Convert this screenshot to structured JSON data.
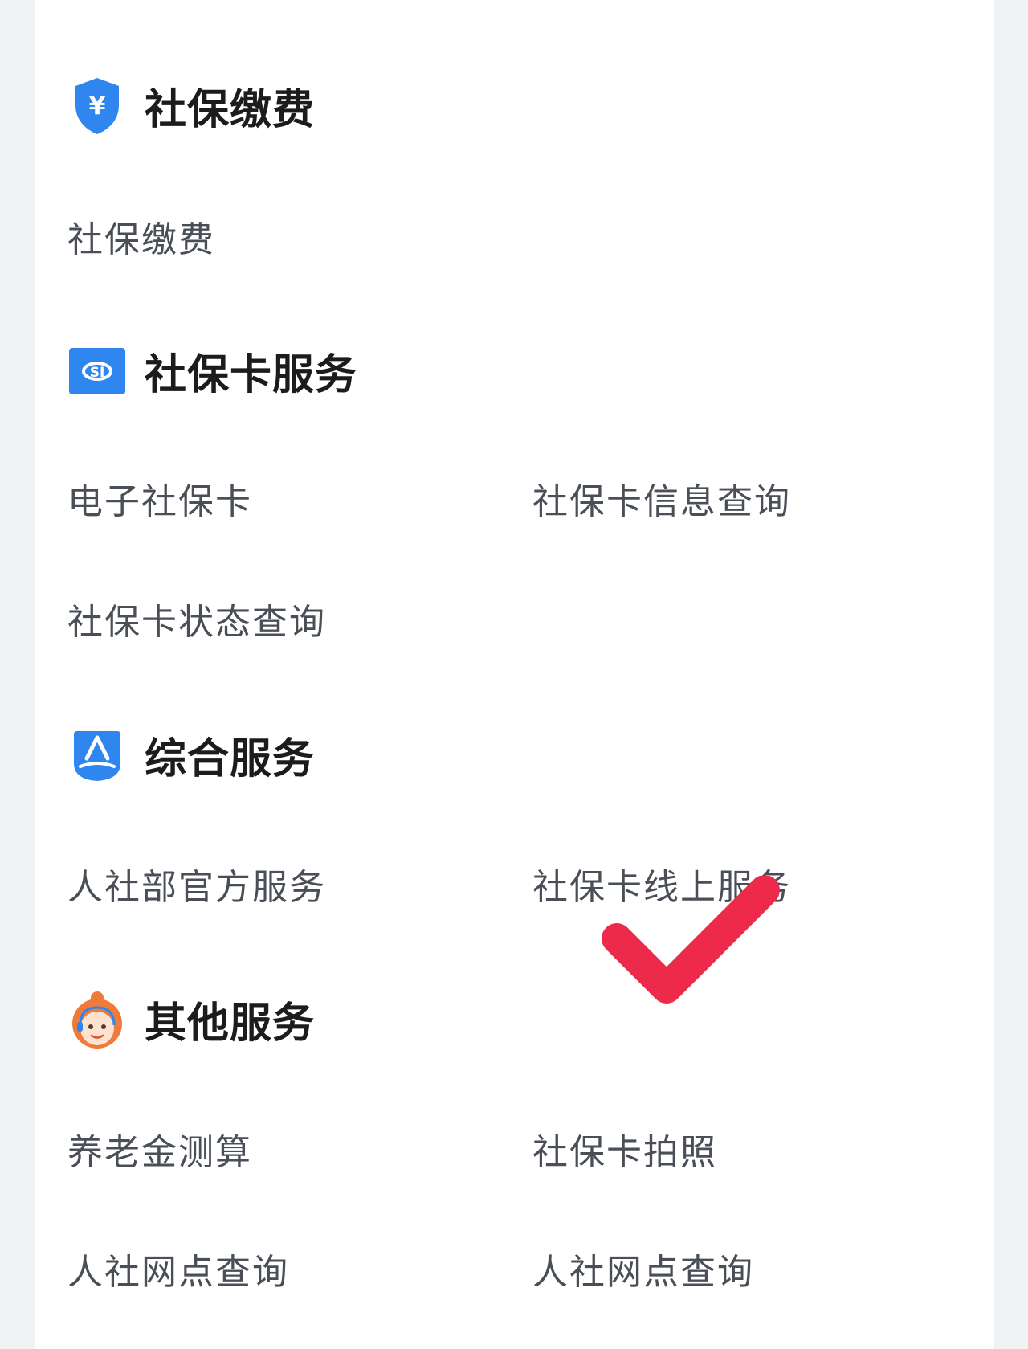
{
  "sections": [
    {
      "title": "社保缴费",
      "icon": "shield-yuan-icon",
      "items": [
        "社保缴费"
      ]
    },
    {
      "title": "社保卡服务",
      "icon": "social-security-card-icon",
      "items": [
        "电子社保卡",
        "社保卡信息查询",
        "社保卡状态查询"
      ]
    },
    {
      "title": "综合服务",
      "icon": "person-service-icon",
      "items": [
        "人社部官方服务",
        "社保卡线上服务"
      ]
    },
    {
      "title": "其他服务",
      "icon": "customer-service-avatar-icon",
      "items": [
        "养老金测算",
        "社保卡拍照",
        "人社网点查询",
        "人社网点查询"
      ]
    }
  ],
  "colors": {
    "accent_blue": "#2f86ee",
    "check_red": "#ee2a4a",
    "avatar_orange": "#f07a3a"
  }
}
